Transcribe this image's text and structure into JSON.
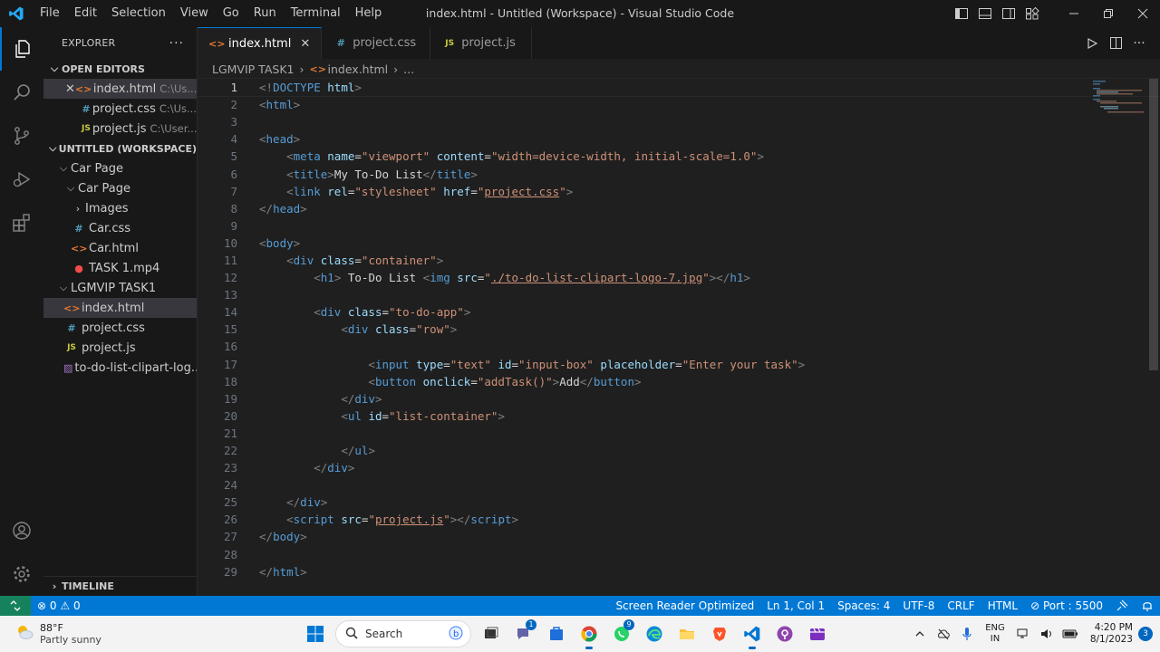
{
  "titlebar": {
    "menu": [
      "File",
      "Edit",
      "Selection",
      "View",
      "Go",
      "Run",
      "Terminal",
      "Help"
    ],
    "window_title": "index.html - Untitled (Workspace) - Visual Studio Code"
  },
  "sidebar": {
    "header": "EXPLORER",
    "open_editors": {
      "title": "OPEN EDITORS",
      "items": [
        {
          "name": "index.html",
          "path": "C:\\Us...",
          "type": "html"
        },
        {
          "name": "project.css",
          "path": "C:\\Us...",
          "type": "css"
        },
        {
          "name": "project.js",
          "path": "C:\\User...",
          "type": "js"
        }
      ]
    },
    "workspace": {
      "title": "UNTITLED (WORKSPACE)",
      "items": [
        {
          "label": "Car Page"
        },
        {
          "label": "Car Page"
        },
        {
          "label": "Images"
        },
        {
          "label": "Car.css"
        },
        {
          "label": "Car.html"
        },
        {
          "label": "TASK 1.mp4"
        },
        {
          "label": "LGMVIP TASK1"
        },
        {
          "label": "index.html"
        },
        {
          "label": "project.css"
        },
        {
          "label": "project.js"
        },
        {
          "label": "to-do-list-clipart-log..."
        }
      ]
    },
    "timeline": "TIMELINE"
  },
  "editor": {
    "tabs": [
      {
        "label": "index.html",
        "type": "html",
        "active": true
      },
      {
        "label": "project.css",
        "type": "css",
        "active": false
      },
      {
        "label": "project.js",
        "type": "js",
        "active": false
      }
    ],
    "breadcrumb": [
      "LGMVIP TASK1",
      "index.html",
      "..."
    ],
    "lines": [
      [
        {
          "c": "br",
          "t": "<!"
        },
        {
          "c": "tag",
          "t": "DOCTYPE"
        },
        {
          "c": "txt",
          "t": " "
        },
        {
          "c": "attr",
          "t": "html"
        },
        {
          "c": "br",
          "t": ">"
        }
      ],
      [
        {
          "c": "br",
          "t": "<"
        },
        {
          "c": "tag",
          "t": "html"
        },
        {
          "c": "br",
          "t": ">"
        }
      ],
      [],
      [
        {
          "c": "br",
          "t": "<"
        },
        {
          "c": "tag",
          "t": "head"
        },
        {
          "c": "br",
          "t": ">"
        }
      ],
      [
        {
          "c": "txt",
          "t": "    "
        },
        {
          "c": "br",
          "t": "<"
        },
        {
          "c": "tag",
          "t": "meta"
        },
        {
          "c": "txt",
          "t": " "
        },
        {
          "c": "attr",
          "t": "name"
        },
        {
          "c": "eq",
          "t": "="
        },
        {
          "c": "str",
          "t": "\"viewport\""
        },
        {
          "c": "txt",
          "t": " "
        },
        {
          "c": "attr",
          "t": "content"
        },
        {
          "c": "eq",
          "t": "="
        },
        {
          "c": "str",
          "t": "\"width=device-width, initial-scale=1.0\""
        },
        {
          "c": "br",
          "t": ">"
        }
      ],
      [
        {
          "c": "txt",
          "t": "    "
        },
        {
          "c": "br",
          "t": "<"
        },
        {
          "c": "tag",
          "t": "title"
        },
        {
          "c": "br",
          "t": ">"
        },
        {
          "c": "txt",
          "t": "My To-Do List"
        },
        {
          "c": "br",
          "t": "</"
        },
        {
          "c": "tag",
          "t": "title"
        },
        {
          "c": "br",
          "t": ">"
        }
      ],
      [
        {
          "c": "txt",
          "t": "    "
        },
        {
          "c": "br",
          "t": "<"
        },
        {
          "c": "tag",
          "t": "link"
        },
        {
          "c": "txt",
          "t": " "
        },
        {
          "c": "attr",
          "t": "rel"
        },
        {
          "c": "eq",
          "t": "="
        },
        {
          "c": "str",
          "t": "\"stylesheet\""
        },
        {
          "c": "txt",
          "t": " "
        },
        {
          "c": "attr",
          "t": "href"
        },
        {
          "c": "eq",
          "t": "="
        },
        {
          "c": "str",
          "t": "\""
        },
        {
          "c": "strlink",
          "t": "project.css"
        },
        {
          "c": "str",
          "t": "\""
        },
        {
          "c": "br",
          "t": ">"
        }
      ],
      [
        {
          "c": "br",
          "t": "</"
        },
        {
          "c": "tag",
          "t": "head"
        },
        {
          "c": "br",
          "t": ">"
        }
      ],
      [],
      [
        {
          "c": "br",
          "t": "<"
        },
        {
          "c": "tag",
          "t": "body"
        },
        {
          "c": "br",
          "t": ">"
        }
      ],
      [
        {
          "c": "txt",
          "t": "    "
        },
        {
          "c": "br",
          "t": "<"
        },
        {
          "c": "tag",
          "t": "div"
        },
        {
          "c": "txt",
          "t": " "
        },
        {
          "c": "attr",
          "t": "class"
        },
        {
          "c": "eq",
          "t": "="
        },
        {
          "c": "str",
          "t": "\"container\""
        },
        {
          "c": "br",
          "t": ">"
        }
      ],
      [
        {
          "c": "txt",
          "t": "        "
        },
        {
          "c": "br",
          "t": "<"
        },
        {
          "c": "tag",
          "t": "h1"
        },
        {
          "c": "br",
          "t": ">"
        },
        {
          "c": "txt",
          "t": " To-Do List "
        },
        {
          "c": "br",
          "t": "<"
        },
        {
          "c": "tag",
          "t": "img"
        },
        {
          "c": "txt",
          "t": " "
        },
        {
          "c": "attr",
          "t": "src"
        },
        {
          "c": "eq",
          "t": "="
        },
        {
          "c": "str",
          "t": "\""
        },
        {
          "c": "strlink",
          "t": "./to-do-list-clipart-logo-7.jpg"
        },
        {
          "c": "str",
          "t": "\""
        },
        {
          "c": "br",
          "t": "></"
        },
        {
          "c": "tag",
          "t": "h1"
        },
        {
          "c": "br",
          "t": ">"
        }
      ],
      [],
      [
        {
          "c": "txt",
          "t": "        "
        },
        {
          "c": "br",
          "t": "<"
        },
        {
          "c": "tag",
          "t": "div"
        },
        {
          "c": "txt",
          "t": " "
        },
        {
          "c": "attr",
          "t": "class"
        },
        {
          "c": "eq",
          "t": "="
        },
        {
          "c": "str",
          "t": "\"to-do-app\""
        },
        {
          "c": "br",
          "t": ">"
        }
      ],
      [
        {
          "c": "txt",
          "t": "            "
        },
        {
          "c": "br",
          "t": "<"
        },
        {
          "c": "tag",
          "t": "div"
        },
        {
          "c": "txt",
          "t": " "
        },
        {
          "c": "attr",
          "t": "class"
        },
        {
          "c": "eq",
          "t": "="
        },
        {
          "c": "str",
          "t": "\"row\""
        },
        {
          "c": "br",
          "t": ">"
        }
      ],
      [],
      [
        {
          "c": "txt",
          "t": "                "
        },
        {
          "c": "br",
          "t": "<"
        },
        {
          "c": "tag",
          "t": "input"
        },
        {
          "c": "txt",
          "t": " "
        },
        {
          "c": "attr",
          "t": "type"
        },
        {
          "c": "eq",
          "t": "="
        },
        {
          "c": "str",
          "t": "\"text\""
        },
        {
          "c": "txt",
          "t": " "
        },
        {
          "c": "attr",
          "t": "id"
        },
        {
          "c": "eq",
          "t": "="
        },
        {
          "c": "str",
          "t": "\"input-box\""
        },
        {
          "c": "txt",
          "t": " "
        },
        {
          "c": "attr",
          "t": "placeholder"
        },
        {
          "c": "eq",
          "t": "="
        },
        {
          "c": "str",
          "t": "\"Enter your task\""
        },
        {
          "c": "br",
          "t": ">"
        }
      ],
      [
        {
          "c": "txt",
          "t": "                "
        },
        {
          "c": "br",
          "t": "<"
        },
        {
          "c": "tag",
          "t": "button"
        },
        {
          "c": "txt",
          "t": " "
        },
        {
          "c": "attr",
          "t": "onclick"
        },
        {
          "c": "eq",
          "t": "="
        },
        {
          "c": "str",
          "t": "\"addTask()\""
        },
        {
          "c": "br",
          "t": ">"
        },
        {
          "c": "txt",
          "t": "Add"
        },
        {
          "c": "br",
          "t": "</"
        },
        {
          "c": "tag",
          "t": "button"
        },
        {
          "c": "br",
          "t": ">"
        }
      ],
      [
        {
          "c": "txt",
          "t": "            "
        },
        {
          "c": "br",
          "t": "</"
        },
        {
          "c": "tag",
          "t": "div"
        },
        {
          "c": "br",
          "t": ">"
        }
      ],
      [
        {
          "c": "txt",
          "t": "            "
        },
        {
          "c": "br",
          "t": "<"
        },
        {
          "c": "tag",
          "t": "ul"
        },
        {
          "c": "txt",
          "t": " "
        },
        {
          "c": "attr",
          "t": "id"
        },
        {
          "c": "eq",
          "t": "="
        },
        {
          "c": "str",
          "t": "\"list-container\""
        },
        {
          "c": "br",
          "t": ">"
        }
      ],
      [],
      [
        {
          "c": "txt",
          "t": "            "
        },
        {
          "c": "br",
          "t": "</"
        },
        {
          "c": "tag",
          "t": "ul"
        },
        {
          "c": "br",
          "t": ">"
        }
      ],
      [
        {
          "c": "txt",
          "t": "        "
        },
        {
          "c": "br",
          "t": "</"
        },
        {
          "c": "tag",
          "t": "div"
        },
        {
          "c": "br",
          "t": ">"
        }
      ],
      [],
      [
        {
          "c": "txt",
          "t": "    "
        },
        {
          "c": "br",
          "t": "</"
        },
        {
          "c": "tag",
          "t": "div"
        },
        {
          "c": "br",
          "t": ">"
        }
      ],
      [
        {
          "c": "txt",
          "t": "    "
        },
        {
          "c": "br",
          "t": "<"
        },
        {
          "c": "tag",
          "t": "script"
        },
        {
          "c": "txt",
          "t": " "
        },
        {
          "c": "attr",
          "t": "src"
        },
        {
          "c": "eq",
          "t": "="
        },
        {
          "c": "str",
          "t": "\""
        },
        {
          "c": "strlink",
          "t": "project.js"
        },
        {
          "c": "str",
          "t": "\""
        },
        {
          "c": "br",
          "t": "></"
        },
        {
          "c": "tag",
          "t": "script"
        },
        {
          "c": "br",
          "t": ">"
        }
      ],
      [
        {
          "c": "br",
          "t": "</"
        },
        {
          "c": "tag",
          "t": "body"
        },
        {
          "c": "br",
          "t": ">"
        }
      ],
      [],
      [
        {
          "c": "br",
          "t": "</"
        },
        {
          "c": "tag",
          "t": "html"
        },
        {
          "c": "br",
          "t": ">"
        }
      ]
    ]
  },
  "statusbar": {
    "errors": "0",
    "warnings": "0",
    "screen_reader": "Screen Reader Optimized",
    "position": "Ln 1, Col 1",
    "spaces": "Spaces: 4",
    "encoding": "UTF-8",
    "eol": "CRLF",
    "language": "HTML",
    "port": "Port : 5500"
  },
  "taskbar": {
    "temperature": "88°F",
    "condition": "Partly sunny",
    "search_label": "Search",
    "teams_badge": "1",
    "whatsapp_badge": "9",
    "lang_top": "ENG",
    "lang_bottom": "IN",
    "time": "4:20 PM",
    "date": "8/1/2023",
    "notifications": "3"
  },
  "colors": {
    "accent": "#0078d4",
    "remote": "#16825d",
    "tag": "#569cd6",
    "attribute": "#9cdcfe",
    "string": "#ce9178"
  }
}
